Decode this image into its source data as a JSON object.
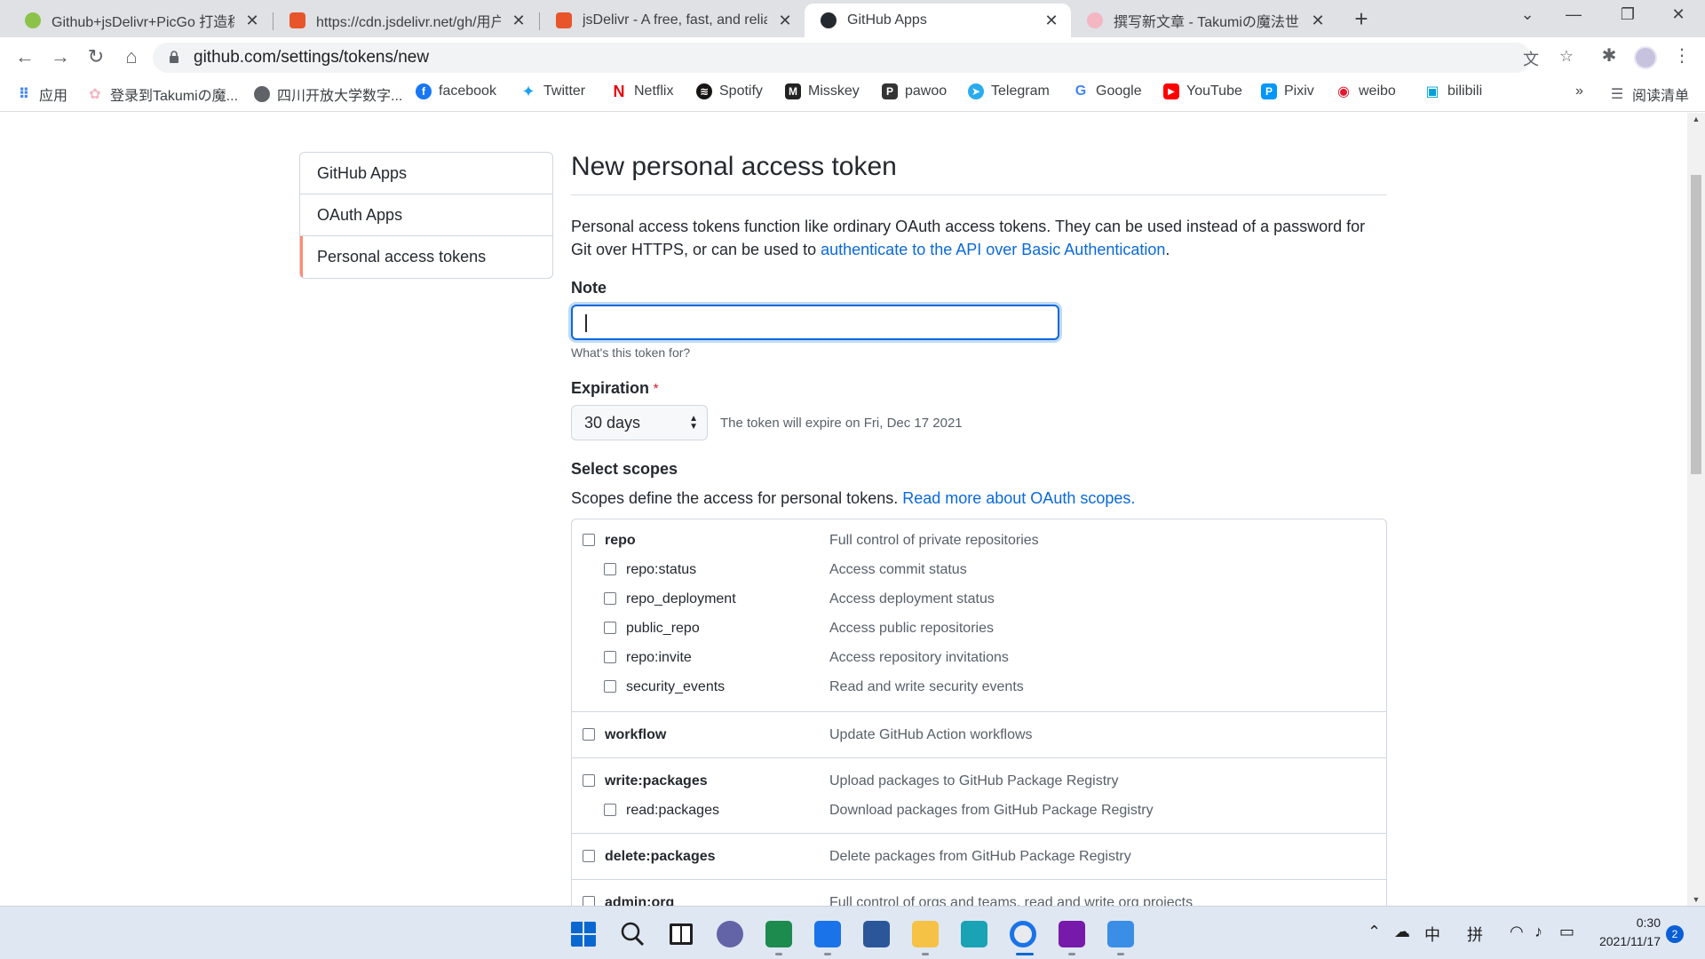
{
  "tabs": [
    {
      "title": "Github+jsDelivr+PicGo 打造稳",
      "color": "#8bc34a"
    },
    {
      "title": "https://cdn.jsdelivr.net/gh/用户",
      "color": "#e8552a"
    },
    {
      "title": "jsDelivr - A free, fast, and reliab",
      "color": "#e8552a"
    },
    {
      "title": "GitHub Apps",
      "color": "#24292f"
    },
    {
      "title": "撰写新文章 - Takumiの魔法世界",
      "color": "#f4b6c2"
    }
  ],
  "url": "github.com/settings/tokens/new",
  "bookmarks": [
    {
      "label": "应用",
      "color": "#4285f4",
      "glyph": "⠿"
    },
    {
      "label": "登录到Takumiの魔...",
      "color": "#f4b6c2",
      "glyph": "✿"
    },
    {
      "label": "四川开放大学数字...",
      "color": "#5f6368",
      "glyph": "◍"
    },
    {
      "label": "facebook",
      "color": "#1877f2",
      "glyph": "f"
    },
    {
      "label": "Twitter",
      "color": "#1da1f2",
      "glyph": "t"
    },
    {
      "label": "Netflix",
      "color": "#e50914",
      "glyph": "N"
    },
    {
      "label": "Spotify",
      "color": "#191414",
      "glyph": "≋"
    },
    {
      "label": "Misskey",
      "color": "#222222",
      "glyph": "M"
    },
    {
      "label": "pawoo",
      "color": "#333333",
      "glyph": "P"
    },
    {
      "label": "Telegram",
      "color": "#2aabee",
      "glyph": "➤"
    },
    {
      "label": "Google",
      "color": "#4285f4",
      "glyph": "G"
    },
    {
      "label": "YouTube",
      "color": "#ff0000",
      "glyph": "▶"
    },
    {
      "label": "Pixiv",
      "color": "#0096fa",
      "glyph": "P"
    },
    {
      "label": "weibo",
      "color": "#e6162d",
      "glyph": "w"
    },
    {
      "label": "bilibili",
      "color": "#00a1d6",
      "glyph": "b"
    }
  ],
  "reading_list": "阅读清单",
  "sidebar": {
    "items": [
      {
        "label": "GitHub Apps"
      },
      {
        "label": "OAuth Apps"
      },
      {
        "label": "Personal access tokens"
      }
    ]
  },
  "main": {
    "title": "New personal access token",
    "intro_text": "Personal access tokens function like ordinary OAuth access tokens. They can be used instead of a password for Git over HTTPS, or can be used to ",
    "intro_link": "authenticate to the API over Basic Authentication",
    "intro_end": ".",
    "note_label": "Note",
    "note_value": "",
    "note_hint": "What's this token for?",
    "expiration_label": "Expiration",
    "expiration_required": "*",
    "expiration_value": "30 days",
    "expiration_note": "The token will expire on Fri, Dec 17 2021",
    "scopes_label": "Select scopes",
    "scopes_text": "Scopes define the access for personal tokens. ",
    "scopes_link": "Read more about OAuth scopes."
  },
  "scopes": [
    {
      "name": "repo",
      "desc": "Full control of private repositories",
      "children": [
        {
          "name": "repo:status",
          "desc": "Access commit status"
        },
        {
          "name": "repo_deployment",
          "desc": "Access deployment status"
        },
        {
          "name": "public_repo",
          "desc": "Access public repositories"
        },
        {
          "name": "repo:invite",
          "desc": "Access repository invitations"
        },
        {
          "name": "security_events",
          "desc": "Read and write security events"
        }
      ]
    },
    {
      "name": "workflow",
      "desc": "Update GitHub Action workflows",
      "children": []
    },
    {
      "name": "write:packages",
      "desc": "Upload packages to GitHub Package Registry",
      "children": [
        {
          "name": "read:packages",
          "desc": "Download packages from GitHub Package Registry"
        }
      ]
    },
    {
      "name": "delete:packages",
      "desc": "Delete packages from GitHub Package Registry",
      "children": []
    },
    {
      "name": "admin:org",
      "desc": "Full control of orgs and teams, read and write org projects",
      "children": []
    }
  ],
  "taskbar": {
    "tray_ime": "中",
    "tray_pinyin": "拼",
    "time": "0:30",
    "date": "2021/11/17",
    "notifications": "2"
  }
}
